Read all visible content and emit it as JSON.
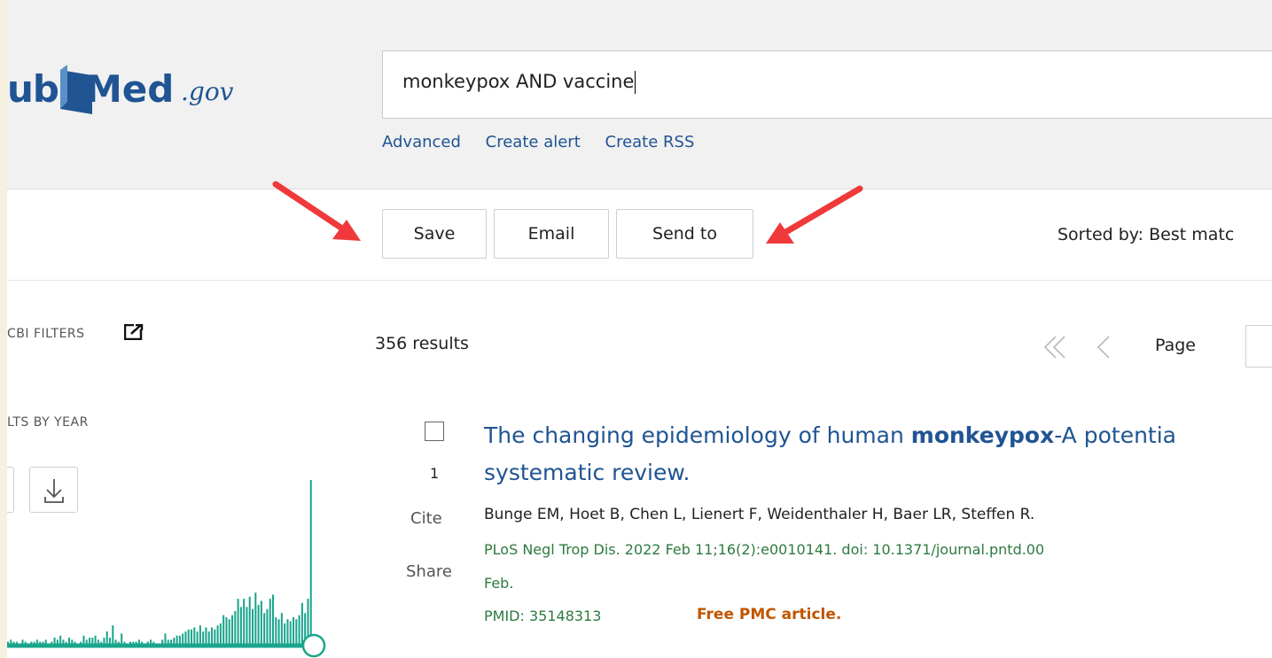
{
  "logo": {
    "part1": "ub",
    "part2": "Med",
    "part3": ".gov"
  },
  "search": {
    "query": "monkeypox AND vaccine",
    "links": [
      "Advanced",
      "Create alert",
      "Create RSS"
    ]
  },
  "actions": {
    "save": "Save",
    "email": "Email",
    "send_to": "Send to",
    "sorted_by": "Sorted by: Best matc"
  },
  "sidebar": {
    "filters_title": "CBI FILTERS",
    "by_year_title": "LTS BY YEAR"
  },
  "chart_data": {
    "type": "bar",
    "title": "LTS BY YEAR",
    "values": [
      1,
      2,
      1,
      1,
      0,
      2,
      1,
      0,
      1,
      1,
      2,
      1,
      1,
      2,
      0,
      1,
      3,
      2,
      4,
      2,
      1,
      3,
      2,
      1,
      0,
      1,
      4,
      2,
      3,
      3,
      4,
      2,
      1,
      3,
      6,
      3,
      9,
      2,
      1,
      5,
      1,
      0,
      1,
      1,
      1,
      2,
      1,
      0,
      1,
      2,
      1,
      0,
      0,
      2,
      5,
      2,
      2,
      3,
      4,
      4,
      5,
      6,
      7,
      7,
      8,
      6,
      9,
      6,
      8,
      6,
      8,
      7,
      9,
      10,
      14,
      13,
      12,
      14,
      16,
      22,
      18,
      22,
      18,
      23,
      17,
      25,
      19,
      21,
      15,
      17,
      22,
      24,
      13,
      12,
      15,
      10,
      12,
      11,
      13,
      12,
      14,
      20,
      15,
      22,
      80
    ]
  },
  "results": {
    "count": "356 results",
    "page_label": "Page",
    "items": [
      {
        "number": "1",
        "cite": "Cite",
        "share": "Share",
        "title_line1_pre": "The changing epidemiology of human ",
        "title_line1_bold": "monkeypox",
        "title_line1_post": "-A potentia",
        "title_line2": "systematic review.",
        "authors": "Bunge EM, Hoet B, Chen L, Lienert F, Weidenthaler H, Baer LR, Steffen R.",
        "journal": "PLoS Negl Trop Dis. 2022 Feb 11;16(2):e0010141. doi: 10.1371/journal.pntd.00",
        "journal_cont": "Feb.",
        "pmid": "PMID: 35148313",
        "free": "Free PMC article."
      }
    ]
  },
  "colors": {
    "link": "#205493",
    "arrow": "#f0393a",
    "chart": "#1aa58c",
    "free_badge": "#c05600",
    "journal": "#2d7a3f"
  }
}
